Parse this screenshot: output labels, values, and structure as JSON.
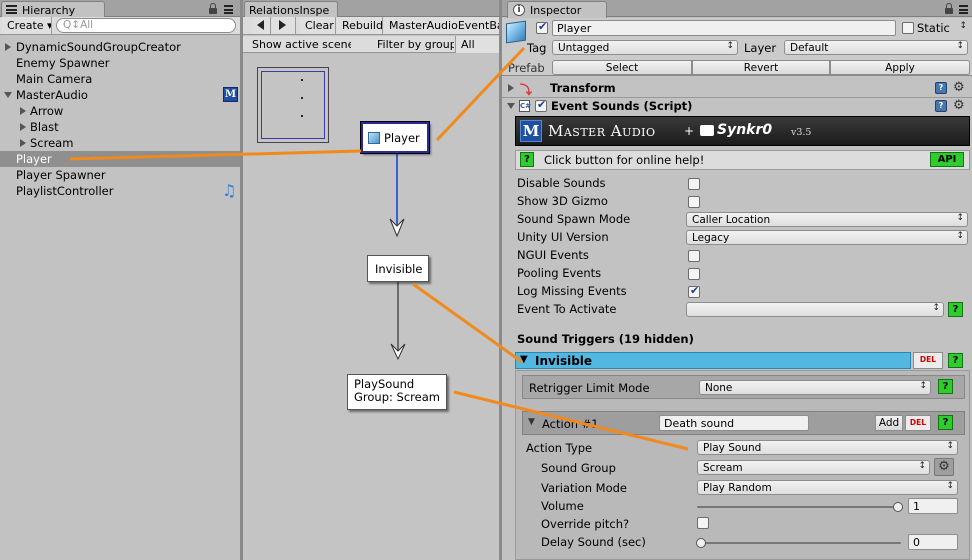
{
  "hierarchy": {
    "tab_label": "Hierarchy",
    "create_label": "Create ▾",
    "search_placeholder": "Q↕All",
    "items": [
      {
        "label": "DynamicSoundGroupCreator",
        "expandable": true
      },
      {
        "label": "Enemy Spawner",
        "expandable": false
      },
      {
        "label": "Main Camera",
        "expandable": false
      },
      {
        "label": "MasterAudio",
        "expandable": true
      },
      {
        "label": "Arrow",
        "expandable": true
      },
      {
        "label": "Blast",
        "expandable": true
      },
      {
        "label": "Scream",
        "expandable": true
      },
      {
        "label": "Player",
        "expandable": false,
        "selected": true
      },
      {
        "label": "Player Spawner",
        "expandable": false
      },
      {
        "label": "PlaylistController",
        "expandable": false
      }
    ]
  },
  "relations": {
    "tab_label": "RelationsInspe",
    "buttons": {
      "clear": "Clear",
      "rebuild": "Rebuild",
      "master_audio": "MasterAudioEventBa"
    },
    "toolbar2": {
      "show_active_scene": "Show active scene",
      "filter_by_group": "Filter by group",
      "all": "All"
    },
    "nodes": {
      "player": "Player",
      "invisible": "Invisible",
      "playsound_line1": "PlaySound",
      "playsound_line2": "Group: Scream"
    }
  },
  "inspector": {
    "tab_label": "Inspector",
    "object_name": "Player",
    "object_enabled": true,
    "static_label": "Static",
    "static_checked": false,
    "tag_label": "Tag",
    "tag_value": "Untagged",
    "layer_label": "Layer",
    "layer_value": "Default",
    "prefab_label": "Prefab",
    "prefab_buttons": {
      "select": "Select",
      "revert": "Revert",
      "apply": "Apply"
    },
    "transform_label": "Transform",
    "script_label": "Event Sounds (Script)",
    "script_enabled": true,
    "banner": {
      "title": "Master Audio",
      "plus": "+",
      "brand": "Synkr0",
      "version": "v3.5"
    },
    "help": {
      "text": "Click button for online help!",
      "q": "?",
      "api": "API"
    },
    "fields": [
      {
        "label": "Disable Sounds",
        "type": "checkbox",
        "checked": false
      },
      {
        "label": "Show 3D Gizmo",
        "type": "checkbox",
        "checked": false
      },
      {
        "label": "Sound Spawn Mode",
        "type": "popup",
        "value": "Caller Location"
      },
      {
        "label": "Unity UI Version",
        "type": "popup",
        "value": "Legacy"
      },
      {
        "label": "NGUI Events",
        "type": "checkbox",
        "checked": false
      },
      {
        "label": "Pooling Events",
        "type": "checkbox",
        "checked": false
      },
      {
        "label": "Log Missing Events",
        "type": "checkbox",
        "checked": true
      },
      {
        "label": "Event To Activate",
        "type": "popup",
        "value": ""
      }
    ],
    "sound_triggers_label": "Sound Triggers (19 hidden)",
    "trigger": {
      "name": "Invisible",
      "del": "DEL",
      "q": "?",
      "retrigger_label": "Retrigger Limit Mode",
      "retrigger_value": "None",
      "action_label": "Action #1",
      "action_name": "Death sound",
      "add_label": "Add",
      "action_type_label": "Action Type",
      "action_type_value": "Play Sound",
      "sound_group_label": "Sound Group",
      "sound_group_value": "Scream",
      "variation_mode_label": "Variation Mode",
      "variation_mode_value": "Play Random",
      "volume_label": "Volume",
      "volume_value": "1",
      "volume_fraction": 1,
      "override_pitch_label": "Override pitch?",
      "override_pitch_checked": false,
      "delay_label": "Delay Sound (sec)",
      "delay_value": "0",
      "delay_fraction": 0
    }
  },
  "colors": {
    "trigger_header": "#52b8e2",
    "annotation_arrow": "#f08a1c",
    "graph_link": "#3a5fd0",
    "help_button": "#2ecc2e",
    "del_text": "#cc0000"
  }
}
